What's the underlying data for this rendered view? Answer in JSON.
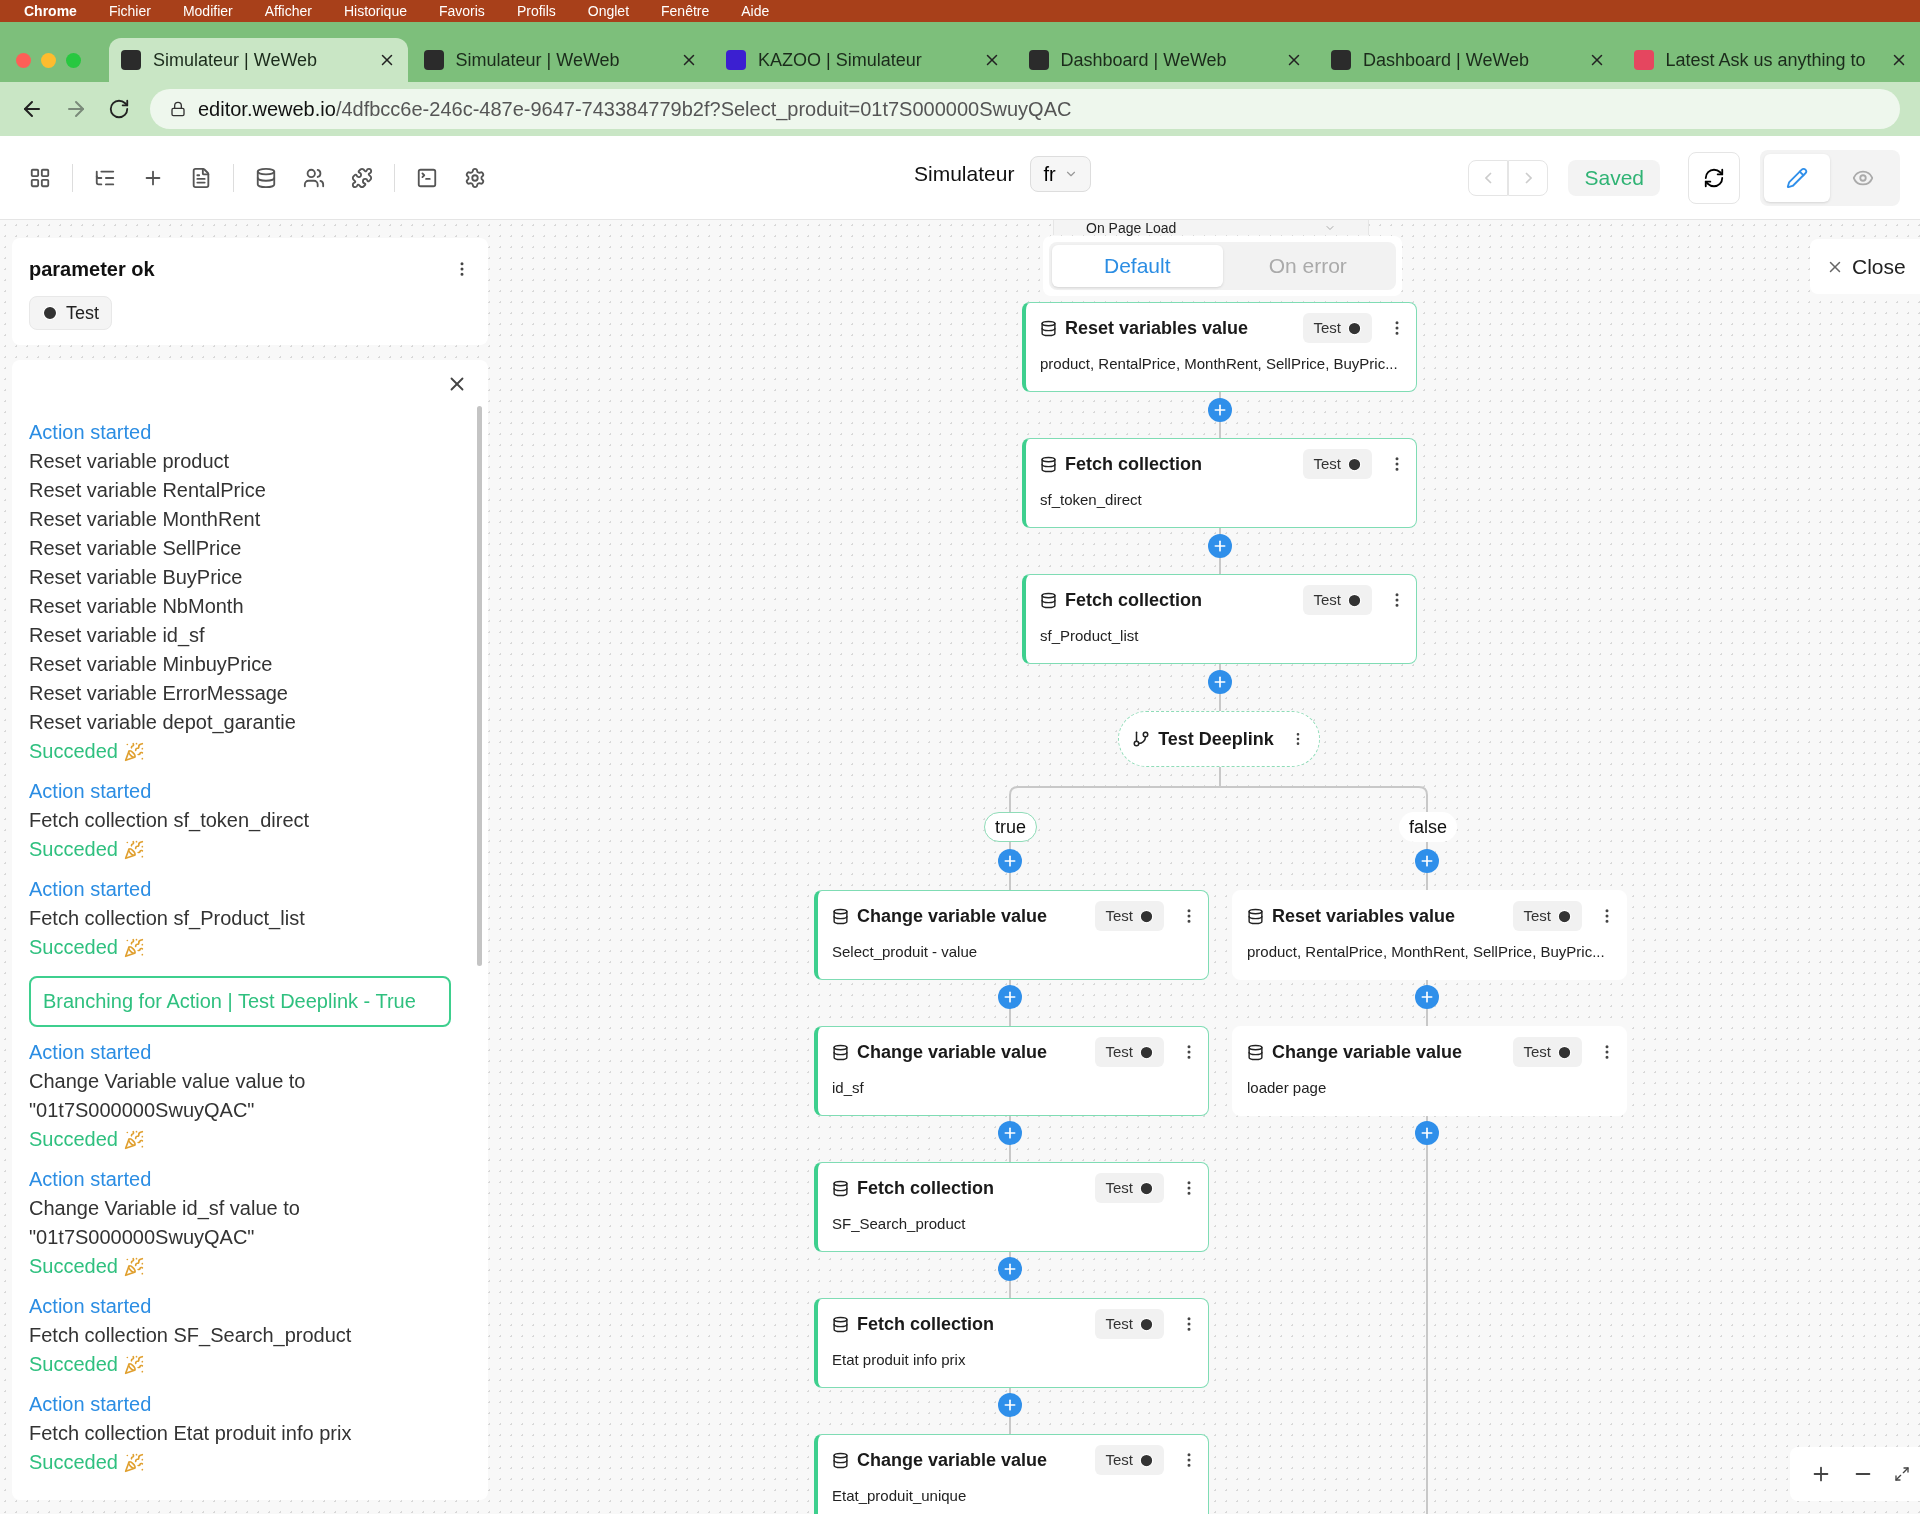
{
  "menu_bar": [
    "Chrome",
    "Fichier",
    "Modifier",
    "Afficher",
    "Historique",
    "Favoris",
    "Profils",
    "Onglet",
    "Fenêtre",
    "Aide"
  ],
  "tabs": [
    {
      "title": "Simulateur | WeWeb",
      "selected": true,
      "color": "#2b2b2b"
    },
    {
      "title": "Simulateur | WeWeb",
      "selected": false,
      "color": "#2b2b2b"
    },
    {
      "title": "KAZOO | Simulateur",
      "selected": false,
      "color": "#3b1fd1"
    },
    {
      "title": "Dashboard | WeWeb",
      "selected": false,
      "color": "#2b2b2b"
    },
    {
      "title": "Dashboard | WeWeb",
      "selected": false,
      "color": "#2b2b2b"
    },
    {
      "title": "Latest Ask us anything to",
      "selected": false,
      "color": "#e5465f"
    }
  ],
  "address": {
    "host": "editor.weweb.io",
    "path": "/4dfbcc6e-246c-487e-9647-743384779b2f?Select_produit=01t7S000000SwuyQAC"
  },
  "toolbar": {
    "page": "Simulateur",
    "lang": "fr",
    "status": "Saved",
    "modes": [
      {
        "kind": "edit",
        "selected": true
      },
      {
        "kind": "preview",
        "selected": false
      }
    ]
  },
  "workflow_card": {
    "name": "parameter ok",
    "test": "Test"
  },
  "log": [
    {
      "kind": "started",
      "text": "Action started"
    },
    {
      "kind": "line",
      "text": "Reset variable product"
    },
    {
      "kind": "line",
      "text": "Reset variable RentalPrice"
    },
    {
      "kind": "line",
      "text": "Reset variable MonthRent"
    },
    {
      "kind": "line",
      "text": "Reset variable SellPrice"
    },
    {
      "kind": "line",
      "text": "Reset variable BuyPrice"
    },
    {
      "kind": "line",
      "text": "Reset variable NbMonth"
    },
    {
      "kind": "line",
      "text": "Reset variable id_sf"
    },
    {
      "kind": "line",
      "text": "Reset variable MinbuyPrice"
    },
    {
      "kind": "line",
      "text": "Reset variable ErrorMessage"
    },
    {
      "kind": "line",
      "text": "Reset variable depot_garantie"
    },
    {
      "kind": "success",
      "text": "Succeded"
    },
    {
      "kind": "started",
      "text": "Action started"
    },
    {
      "kind": "line",
      "text": "Fetch collection sf_token_direct"
    },
    {
      "kind": "success",
      "text": "Succeded"
    },
    {
      "kind": "started",
      "text": "Action started"
    },
    {
      "kind": "line",
      "text": "Fetch collection sf_Product_list"
    },
    {
      "kind": "success",
      "text": "Succeded"
    },
    {
      "kind": "branch",
      "text": "Branching for Action | Test Deeplink - True"
    },
    {
      "kind": "started",
      "text": "Action started"
    },
    {
      "kind": "line",
      "text": "Change Variable value value to \"01t7S000000SwuyQAC\""
    },
    {
      "kind": "success",
      "text": "Succeded"
    },
    {
      "kind": "started",
      "text": "Action started"
    },
    {
      "kind": "line",
      "text": "Change Variable id_sf value to \"01t7S000000SwuyQAC\""
    },
    {
      "kind": "success",
      "text": "Succeded"
    },
    {
      "kind": "started",
      "text": "Action started"
    },
    {
      "kind": "line",
      "text": "Fetch collection SF_Search_product"
    },
    {
      "kind": "success",
      "text": "Succeded"
    },
    {
      "kind": "started",
      "text": "Action started"
    },
    {
      "kind": "line",
      "text": "Fetch collection Etat produit info prix"
    },
    {
      "kind": "success",
      "text": "Succeded"
    }
  ],
  "workflow": {
    "trigger": "On Page Load",
    "tabs": [
      {
        "label": "Default",
        "selected": true
      },
      {
        "label": "On error",
        "selected": false
      }
    ],
    "steps": [
      {
        "title": "Reset variables value",
        "subtitle": "product, RentalPrice, MonthRent, SellPrice, BuyPric...",
        "test": "Test",
        "executed": true
      },
      {
        "title": "Fetch collection",
        "subtitle": "sf_token_direct",
        "test": "Test",
        "executed": true
      },
      {
        "title": "Fetch collection",
        "subtitle": "sf_Product_list",
        "test": "Test",
        "executed": true
      }
    ],
    "branch": {
      "name": "Test Deeplink",
      "true_label": "true",
      "false_label": "false",
      "true_steps": [
        {
          "title": "Change variable value",
          "subtitle": "Select_produit - value",
          "test": "Test",
          "executed": true
        },
        {
          "title": "Change variable value",
          "subtitle": "id_sf",
          "test": "Test",
          "executed": true
        },
        {
          "title": "Fetch collection",
          "subtitle": "SF_Search_product",
          "test": "Test",
          "executed": true
        },
        {
          "title": "Fetch collection",
          "subtitle": "Etat produit info prix",
          "test": "Test",
          "executed": true
        },
        {
          "title": "Change variable value",
          "subtitle": "Etat_produit_unique",
          "test": "Test",
          "executed": true
        }
      ],
      "false_steps": [
        {
          "title": "Reset variables value",
          "subtitle": "product, RentalPrice, MonthRent, SellPrice, BuyPric...",
          "test": "Test",
          "executed": false
        },
        {
          "title": "Change variable value",
          "subtitle": "loader page",
          "test": "Test",
          "executed": false
        }
      ]
    }
  },
  "close": "Close"
}
